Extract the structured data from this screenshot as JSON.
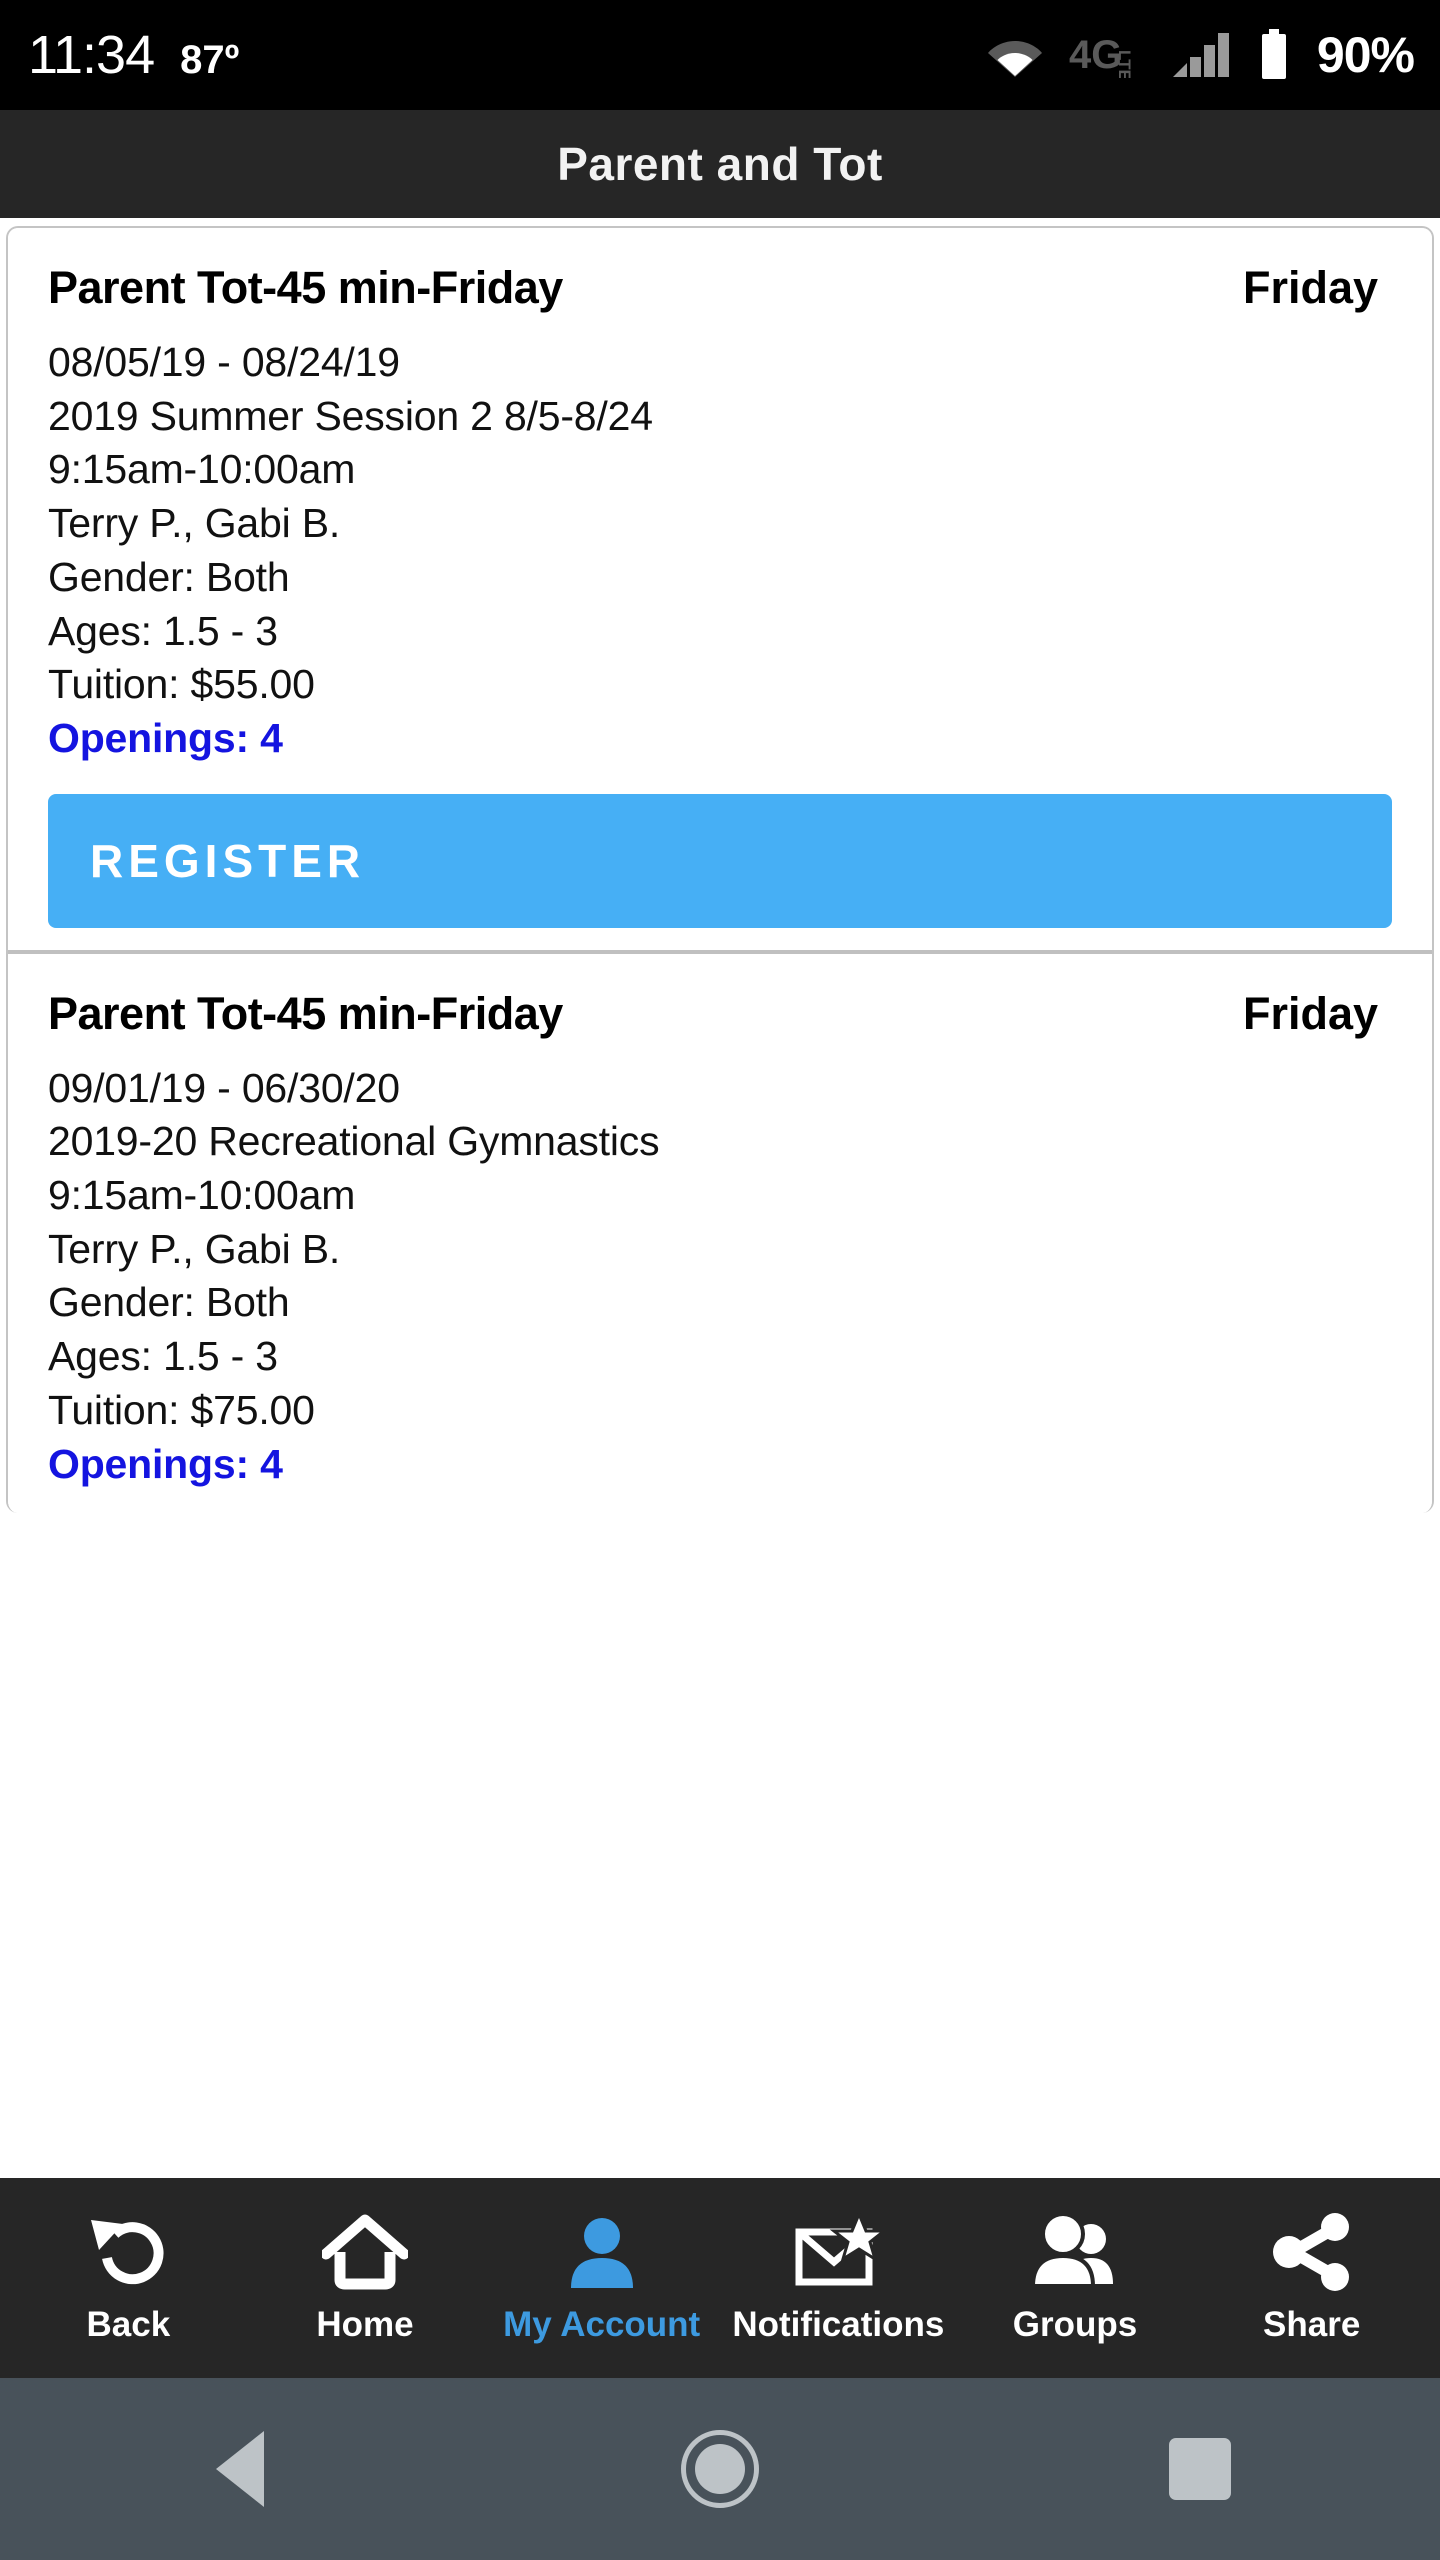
{
  "statusbar": {
    "time": "11:34",
    "temperature": "87º",
    "wifi_icon": "wifi-icon",
    "network_label": "4G",
    "network_sub": "LTE",
    "signal_icon": "signal-bars-icon",
    "battery_icon": "battery-icon",
    "battery_percent": "90%"
  },
  "header": {
    "title": "Parent and Tot"
  },
  "classes": [
    {
      "title": "Parent Tot-45 min-Friday",
      "day": "Friday",
      "date_range": "08/05/19 - 08/24/19",
      "session": "2019 Summer Session 2 8/5-8/24",
      "time": "9:15am-10:00am",
      "instructors": "Terry P., Gabi B.",
      "gender": "Gender: Both",
      "ages": "Ages: 1.5 - 3",
      "tuition": "Tuition: $55.00",
      "openings": "Openings: 4",
      "register_label": "REGISTER"
    },
    {
      "title": "Parent Tot-45 min-Friday",
      "day": "Friday",
      "date_range": "09/01/19 - 06/30/20",
      "session": "2019-20 Recreational Gymnastics",
      "time": "9:15am-10:00am",
      "instructors": "Terry P., Gabi B.",
      "gender": "Gender: Both",
      "ages": "Ages: 1.5 - 3",
      "tuition": "Tuition: $75.00",
      "openings": "Openings: 4"
    }
  ],
  "bottom_nav": {
    "items": [
      {
        "label": "Back",
        "icon": "undo-arrow-icon",
        "active": false
      },
      {
        "label": "Home",
        "icon": "house-icon",
        "active": false
      },
      {
        "label": "My Account",
        "icon": "person-icon",
        "active": true
      },
      {
        "label": "Notifications",
        "icon": "envelope-star-icon",
        "active": false
      },
      {
        "label": "Groups",
        "icon": "people-icon",
        "active": false
      },
      {
        "label": "Share",
        "icon": "share-nodes-icon",
        "active": false
      }
    ]
  },
  "system_nav": {
    "back_icon": "triangle-back-icon",
    "home_icon": "circle-home-icon",
    "recents_icon": "square-recents-icon"
  },
  "colors": {
    "accent_blue": "#46aff5",
    "openings_blue": "#1414e0",
    "active_nav_blue": "#3d9ae0",
    "header_bg": "#262626",
    "sysnav_bg": "#48525a"
  }
}
